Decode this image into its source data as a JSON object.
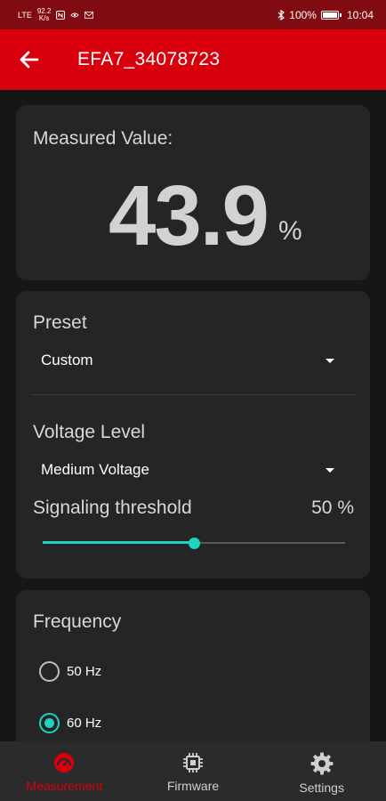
{
  "status_bar": {
    "network": "LTE",
    "speed_value": "92.2",
    "speed_unit": "K/s",
    "battery": "100%",
    "time": "10:04"
  },
  "app_bar": {
    "title": "EFA7_34078723",
    "back_icon": "arrow-left-icon"
  },
  "measurement": {
    "label": "Measured Value:",
    "value": "43.9",
    "unit": "%"
  },
  "settings": {
    "preset_label": "Preset",
    "preset_value": "Custom",
    "voltage_label": "Voltage Level",
    "voltage_value": "Medium Voltage",
    "threshold_label": "Signaling threshold",
    "threshold_value_text": "50 %",
    "threshold_fraction": 0.5
  },
  "frequency": {
    "label": "Frequency",
    "options": [
      {
        "label": "50 Hz",
        "selected": false
      },
      {
        "label": "60 Hz",
        "selected": true
      }
    ]
  },
  "bottom_nav": {
    "items": [
      {
        "label": "Measurement",
        "icon": "gauge-icon",
        "active": true
      },
      {
        "label": "Firmware",
        "icon": "chip-icon",
        "active": false
      },
      {
        "label": "Settings",
        "icon": "gear-icon",
        "active": false
      }
    ]
  },
  "colors": {
    "accent": "#1fd1c1",
    "brand_red": "#d8000c",
    "status_bar": "#800b10",
    "card": "#252525",
    "background": "#161616"
  }
}
